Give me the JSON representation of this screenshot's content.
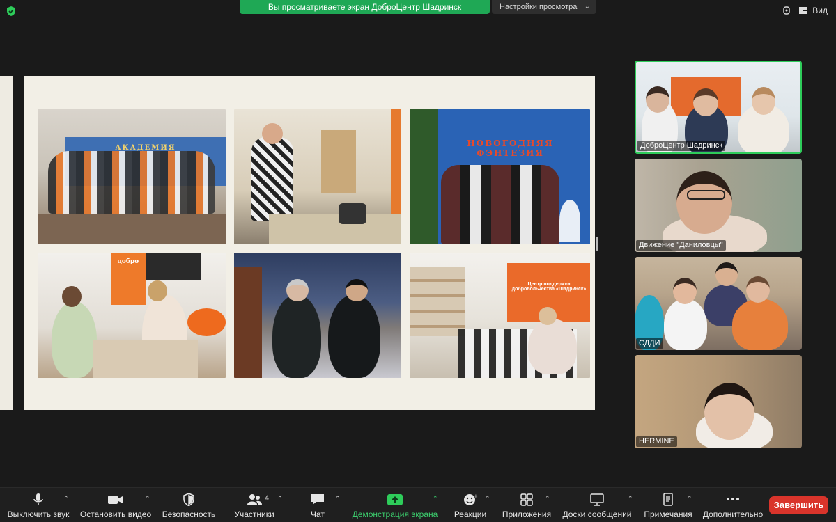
{
  "topbar": {
    "share_banner": "Вы просматриваете экран ДоброЦентр Шадринск",
    "view_settings": "Настройки просмотра",
    "view_button": "Вид"
  },
  "slide": {
    "photos": [
      {
        "caption": "АКАДЕМИЯ"
      },
      {
        "caption": ""
      },
      {
        "caption": "НОВОГОДНЯЯ ФЭНТЕЗИЯ"
      },
      {
        "caption": "добро"
      },
      {
        "caption": ""
      },
      {
        "caption": "Центр поддержки добровольчества «Шадринск»"
      }
    ]
  },
  "participants": [
    {
      "name": "ДоброЦентр Шадринск",
      "active": true
    },
    {
      "name": "Движение \"Даниловцы\"",
      "active": false
    },
    {
      "name": "СДДИ",
      "active": false
    },
    {
      "name": "HERMINE",
      "active": false
    }
  ],
  "toolbar": {
    "mute_label": "Выключить звук",
    "video_label": "Остановить видео",
    "security_label": "Безопасность",
    "participants_label": "Участники",
    "participants_count": "4",
    "chat_label": "Чат",
    "share_label": "Демонстрация экрана",
    "reactions_label": "Реакции",
    "apps_label": "Приложения",
    "whiteboards_label": "Доски сообщений",
    "notes_label": "Примечания",
    "more_label": "Дополнительно",
    "end_label": "Завершить"
  },
  "colors": {
    "accent_green": "#1fa855",
    "end_red": "#d9342b",
    "slide_bg": "#f2efe6"
  }
}
